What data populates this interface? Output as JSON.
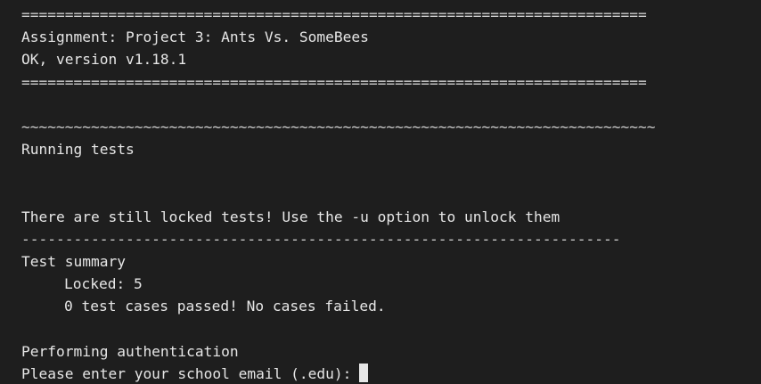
{
  "terminal": {
    "rule_equals": "========================================================================",
    "assignment": "Assignment: Project 3: Ants Vs. SomeBees",
    "version": "OK, version v1.18.1",
    "rule_tilde": "~~~~~~~~~~~~~~~~~~~~~~~~~~~~~~~~~~~~~~~~~~~~~~~~~~~~~~~~~~~~~~~~~~~~~~~~~",
    "running": "Running tests",
    "locked_warning": "There are still locked tests! Use the -u option to unlock them",
    "rule_dash": "---------------------------------------------------------------------",
    "summary_title": "Test summary",
    "locked": "Locked: 5",
    "passed": "0 test cases passed! No cases failed.",
    "auth": "Performing authentication",
    "email_prompt": "Please enter your school email (.edu):"
  }
}
